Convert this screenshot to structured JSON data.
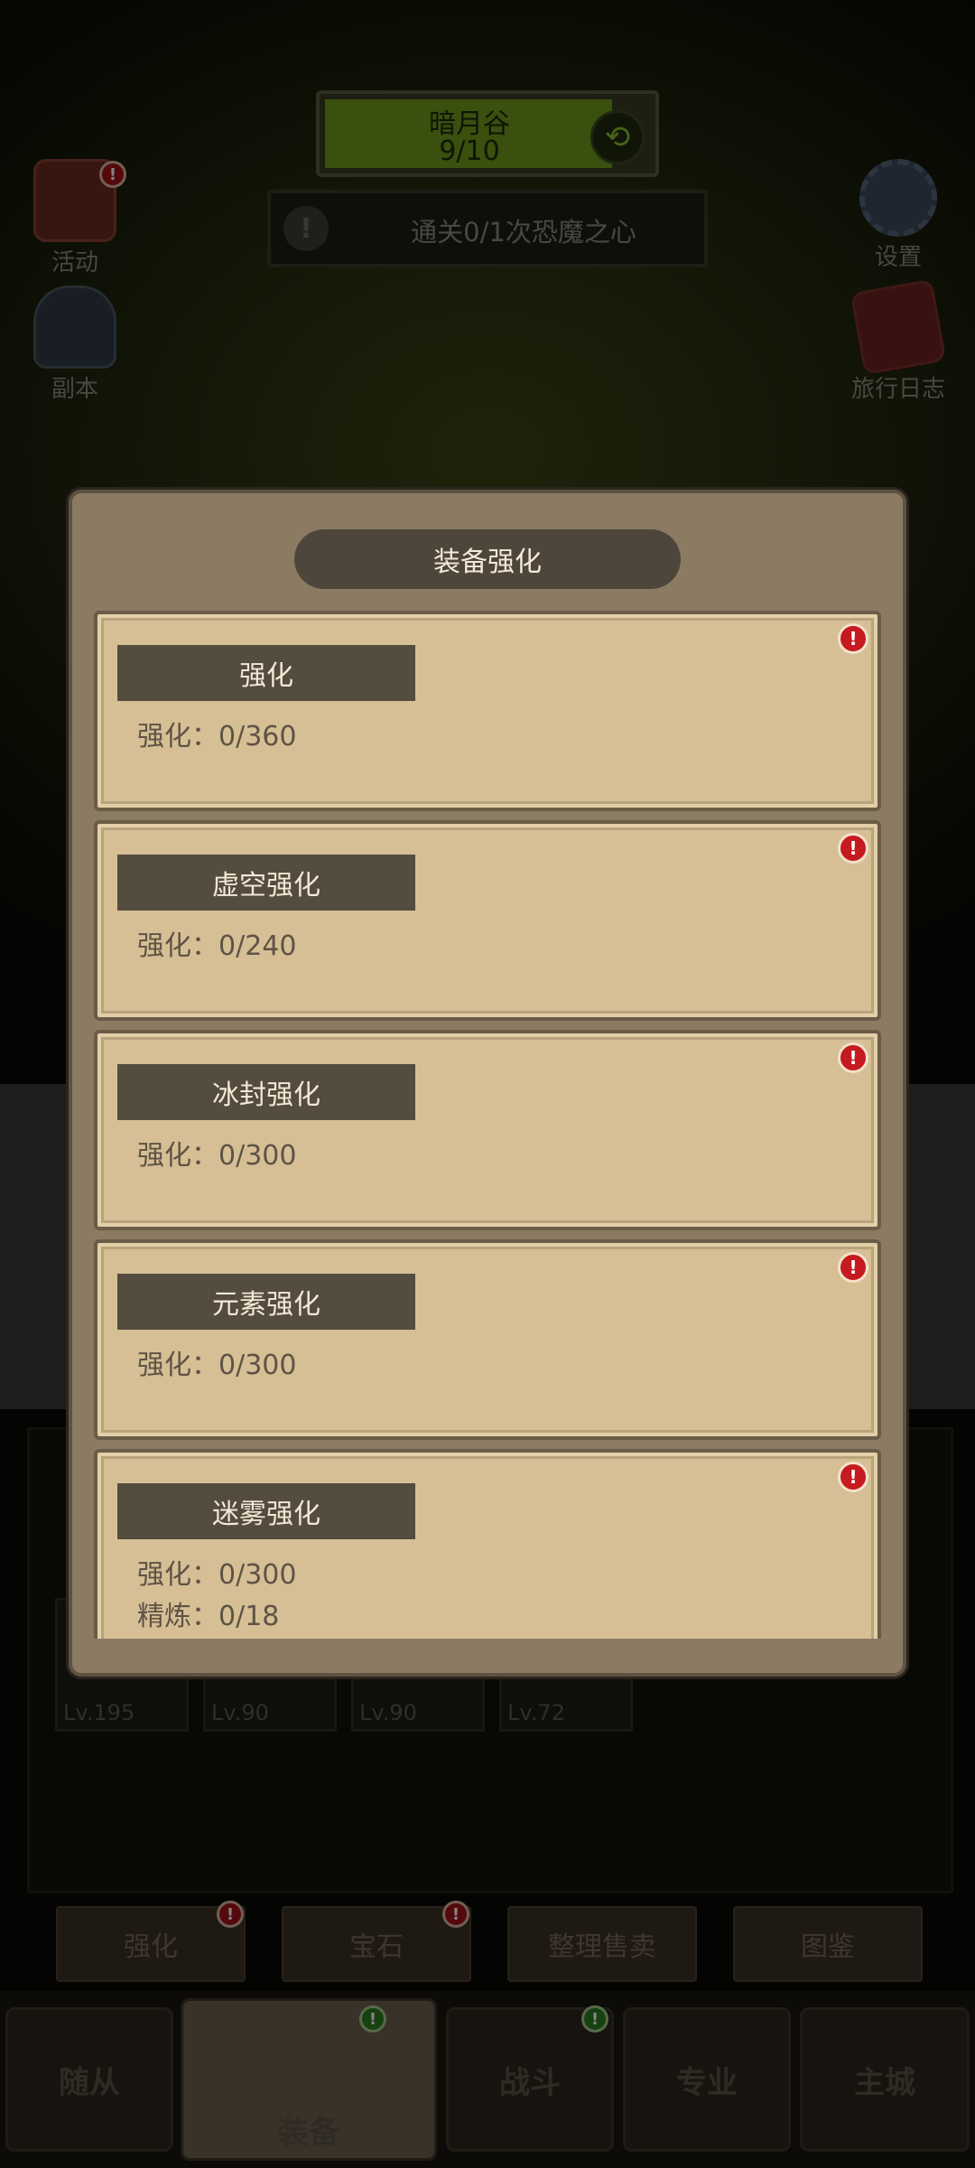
{
  "hud": {
    "stage_name": "暗月谷",
    "stage_progress": "9/10",
    "quest_text": "通关0/1次恐魔之心",
    "left_buttons": [
      {
        "label": "活动",
        "icon": "event-scroll-icon",
        "badge": "!"
      },
      {
        "label": "副本",
        "icon": "dungeon-portal-icon"
      }
    ],
    "right_buttons": [
      {
        "label": "设置",
        "icon": "gear-icon"
      },
      {
        "label": "旅行日志",
        "icon": "journal-book-icon"
      }
    ]
  },
  "modal": {
    "title": "装备强化",
    "cards": [
      {
        "title": "强化",
        "lines": [
          "强化：0/360"
        ],
        "alert": "!"
      },
      {
        "title": "虚空强化",
        "lines": [
          "强化：0/240"
        ],
        "alert": "!"
      },
      {
        "title": "冰封强化",
        "lines": [
          "强化：0/300"
        ],
        "alert": "!"
      },
      {
        "title": "元素强化",
        "lines": [
          "强化：0/300"
        ],
        "alert": "!"
      },
      {
        "title": "迷雾强化",
        "lines": [
          "强化：0/300",
          "精炼：0/18"
        ],
        "alert": "!"
      }
    ]
  },
  "inventory": {
    "levels": [
      "Lv.195",
      "Lv.90",
      "Lv.90",
      "Lv.72"
    ]
  },
  "actions": [
    {
      "label": "强化",
      "badge": "!"
    },
    {
      "label": "宝石",
      "badge": "!"
    },
    {
      "label": "整理售卖"
    },
    {
      "label": "图鉴"
    }
  ],
  "tabs": [
    {
      "label": "随从"
    },
    {
      "label": "装备",
      "badge": "!"
    },
    {
      "label": "战斗",
      "badge": "!"
    },
    {
      "label": "专业"
    },
    {
      "label": "主城"
    }
  ],
  "colors": {
    "accent_green": "#6f9a1c",
    "alert_red": "#c41a20",
    "card_bg": "#d6bf95",
    "modal_bg": "#8b7b63"
  }
}
